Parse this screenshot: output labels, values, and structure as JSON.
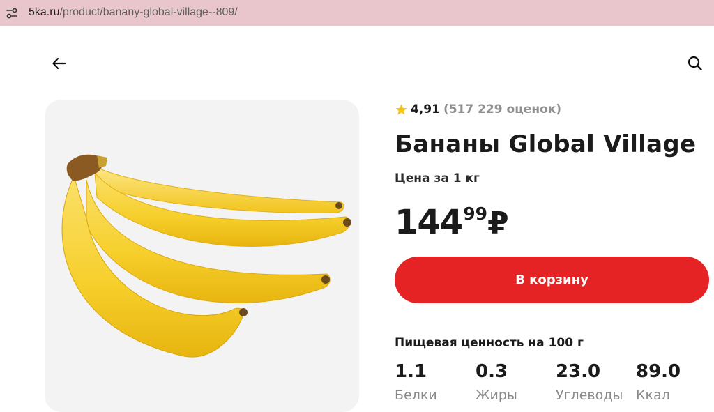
{
  "browser": {
    "url_host": "5ka.ru",
    "url_path": "/product/banany-global-village--809/"
  },
  "header": {
    "back_icon": "arrow-left-icon",
    "search_icon": "search-icon"
  },
  "product": {
    "rating": "4,91",
    "rating_count": "(517 229 оценок)",
    "title": "Бананы Global Village",
    "price_unit": "Цена за 1 кг",
    "price_rub": "144",
    "price_kop": "99",
    "currency": "₽",
    "cart_button": "В корзину",
    "image_alt": "bananas-image"
  },
  "nutrition": {
    "title": "Пищевая ценность на 100 г",
    "items": [
      {
        "value": "1.1",
        "label": "Белки"
      },
      {
        "value": "0.3",
        "label": "Жиры"
      },
      {
        "value": "23.0",
        "label": "Углеводы"
      },
      {
        "value": "89.0",
        "label": "Ккал"
      }
    ]
  },
  "colors": {
    "accent": "#e52224",
    "star": "#f5c518",
    "addressbar": "#e9c6cc"
  }
}
